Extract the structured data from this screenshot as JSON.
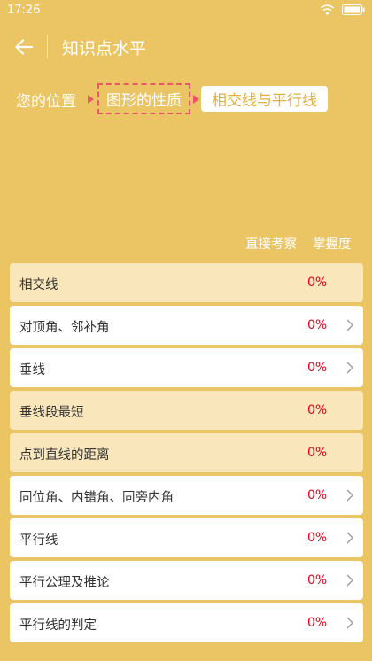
{
  "status": {
    "time": "17:26"
  },
  "header": {
    "title": "知识点水平"
  },
  "breadcrumb": {
    "prefix": "您的位置",
    "parent": "图形的性质",
    "current": "相交线与平行线",
    "arrow_color": "#e9556a"
  },
  "columns": {
    "direct": "直接考察",
    "mastery": "掌握度"
  },
  "colors": {
    "background": "#ebc463",
    "percent": "#e4001b",
    "plain_row": "#f9e6bb"
  },
  "topics": [
    {
      "name": "相交线",
      "percent": "0%",
      "expandable": false
    },
    {
      "name": "对顶角、邻补角",
      "percent": "0%",
      "expandable": true
    },
    {
      "name": "垂线",
      "percent": "0%",
      "expandable": true
    },
    {
      "name": "垂线段最短",
      "percent": "0%",
      "expandable": false
    },
    {
      "name": "点到直线的距离",
      "percent": "0%",
      "expandable": false
    },
    {
      "name": "同位角、内错角、同旁内角",
      "percent": "0%",
      "expandable": true
    },
    {
      "name": "平行线",
      "percent": "0%",
      "expandable": true
    },
    {
      "name": "平行公理及推论",
      "percent": "0%",
      "expandable": true
    },
    {
      "name": "平行线的判定",
      "percent": "0%",
      "expandable": true
    }
  ]
}
